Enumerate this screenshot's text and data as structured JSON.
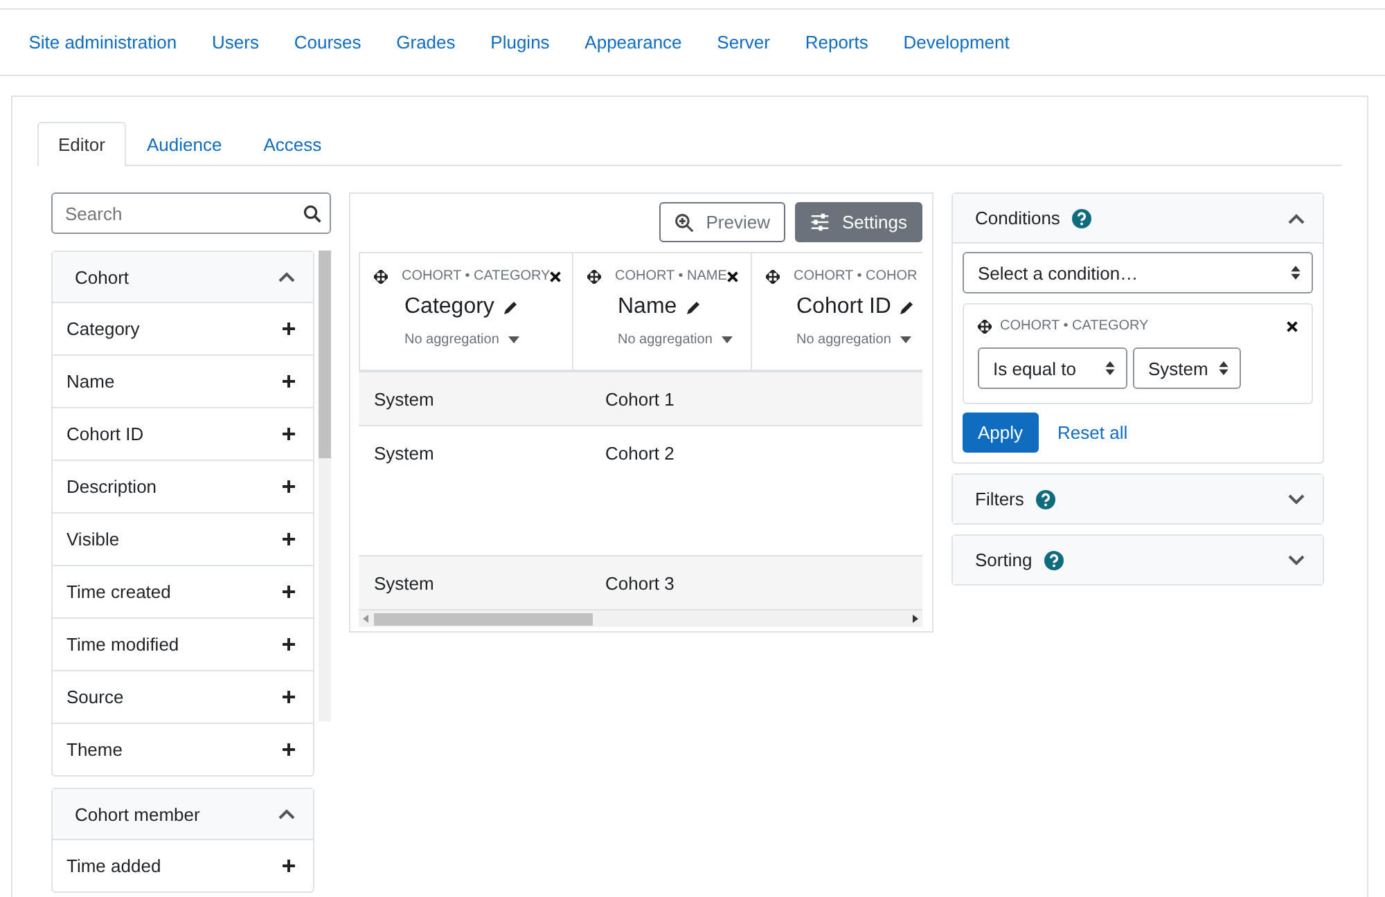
{
  "nav": [
    "Site administration",
    "Users",
    "Courses",
    "Grades",
    "Plugins",
    "Appearance",
    "Server",
    "Reports",
    "Development"
  ],
  "tabs": [
    {
      "label": "Editor",
      "selected": true
    },
    {
      "label": "Audience",
      "selected": false
    },
    {
      "label": "Access",
      "selected": false
    }
  ],
  "search": {
    "placeholder": "Search"
  },
  "sidebar": [
    {
      "title": "Cohort",
      "expanded": true,
      "items": [
        "Category",
        "Name",
        "Cohort ID",
        "Description",
        "Visible",
        "Time created",
        "Time modified",
        "Source",
        "Theme"
      ]
    },
    {
      "title": "Cohort member",
      "expanded": true,
      "items": [
        "Time added"
      ]
    }
  ],
  "buttons": {
    "preview": "Preview",
    "settings": "Settings"
  },
  "columns": [
    {
      "source": "COHORT • CATEGORY",
      "title": "Category",
      "aggregation": "No aggregation"
    },
    {
      "source": "COHORT • NAME",
      "title": "Name",
      "aggregation": "No aggregation"
    },
    {
      "source": "COHORT • COHOR",
      "title": "Cohort ID",
      "aggregation": "No aggregation"
    }
  ],
  "rows": [
    [
      "System",
      "Cohort 1"
    ],
    [
      "System",
      "Cohort 2"
    ],
    [
      "System",
      "Cohort 3"
    ]
  ],
  "conditions": {
    "title": "Conditions",
    "expanded": true,
    "select": "Select a condition…",
    "items": [
      {
        "source": "COHORT • CATEGORY",
        "operator": "Is equal to",
        "value": "System"
      }
    ],
    "apply": "Apply",
    "reset": "Reset all"
  },
  "panels": [
    {
      "title": "Filters",
      "expanded": false
    },
    {
      "title": "Sorting",
      "expanded": false
    }
  ]
}
